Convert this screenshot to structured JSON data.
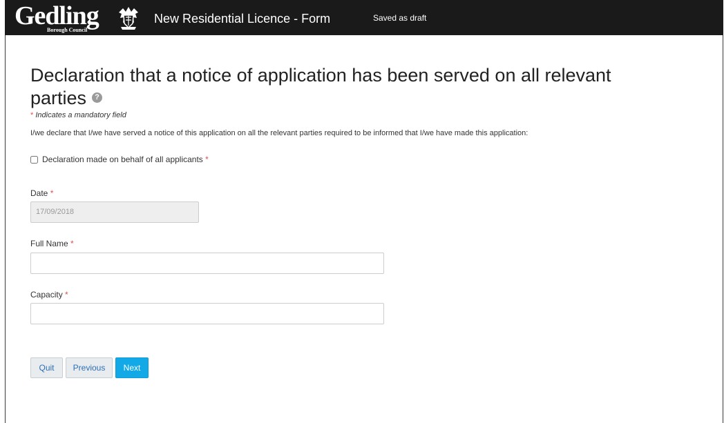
{
  "header": {
    "logo_text": "Gedling",
    "logo_subtext": "Borough Council",
    "app_title": "New Residential Licence - Form",
    "status": "Saved as draft"
  },
  "form": {
    "heading": "Declaration that a notice of application has been served on all relevant parties",
    "help_icon": "?",
    "mandatory_note": "Indicates a mandatory field",
    "required_marker": "*",
    "declaration_text": "I/we declare that I/we have served a notice of this application on all the relevant parties required to be informed that I/we have made this application:",
    "checkbox_label": "Declaration made on behalf of all applicants",
    "checkbox_checked": false,
    "date_label": "Date",
    "date_value": "17/09/2018",
    "full_name_label": "Full Name",
    "full_name_value": "",
    "capacity_label": "Capacity",
    "capacity_value": ""
  },
  "buttons": {
    "quit": "Quit",
    "previous": "Previous",
    "next": "Next"
  },
  "colors": {
    "header_bg": "#1a1a1a",
    "primary_button": "#12a9e6",
    "required": "#d9534f",
    "link_text": "#2a6fb5"
  }
}
